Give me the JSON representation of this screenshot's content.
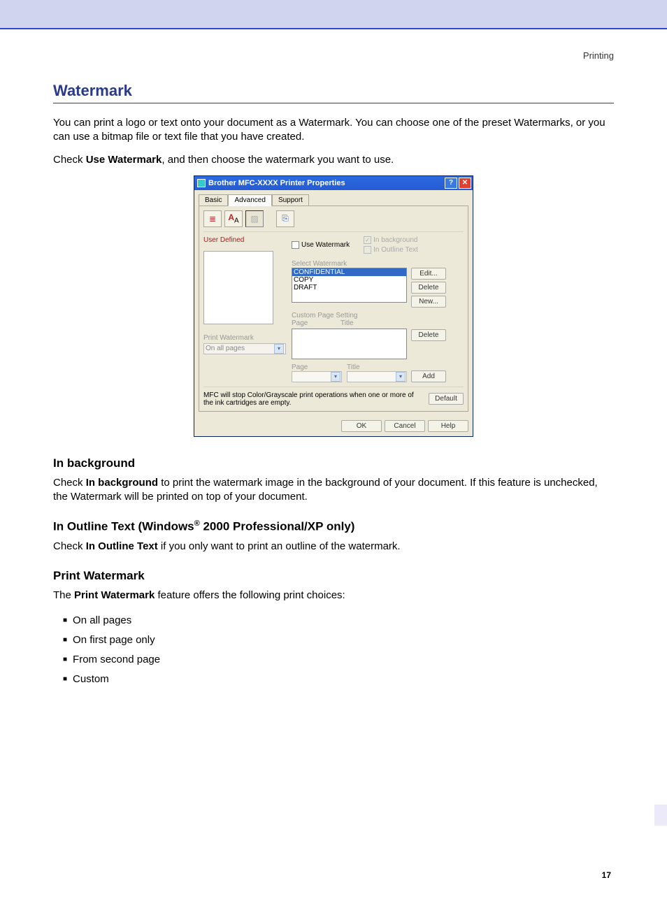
{
  "breadcrumb": "Printing",
  "title": "Watermark",
  "intro1": "You can print a logo or text onto your document as a Watermark. You can choose one of the preset Watermarks, or you can use a bitmap file or text file that you have created.",
  "intro2_pre": "Check ",
  "intro2_bold": "Use Watermark",
  "intro2_post": ", and then choose the watermark you want to use.",
  "dialog": {
    "title": "Brother MFC-XXXX Printer Properties",
    "tabs": {
      "basic": "Basic",
      "advanced": "Advanced",
      "support": "Support"
    },
    "left": {
      "user_defined": "User Defined",
      "print_watermark": "Print Watermark",
      "dd_value": "On all pages"
    },
    "checks": {
      "use_watermark": "Use Watermark",
      "in_background": "In background",
      "in_outline": "In Outline Text"
    },
    "select_label": "Select Watermark",
    "list": {
      "sel": "CONFIDENTIAL",
      "i1": "COPY",
      "i2": "DRAFT"
    },
    "btns": {
      "edit": "Edit...",
      "delete": "Delete",
      "new": "New...",
      "delete2": "Delete",
      "add": "Add",
      "default": "Default"
    },
    "custom_label": "Custom Page Setting",
    "col_page": "Page",
    "col_title": "Title",
    "note": "MFC will stop Color/Grayscale print operations when one or more of the ink cartridges are empty.",
    "footer": {
      "ok": "OK",
      "cancel": "Cancel",
      "help": "Help"
    }
  },
  "sec1": {
    "h": "In background",
    "p_pre": "Check ",
    "p_bold": "In background",
    "p_post": " to print the watermark image in the background of your document. If this feature is unchecked, the Watermark will be printed on top of your document."
  },
  "sec2": {
    "h_pre": "In Outline Text (Windows",
    "h_sup": "®",
    "h_post": " 2000 Professional/XP only)",
    "p_pre": "Check ",
    "p_bold": "In Outline Text",
    "p_post": " if you only want to print an outline of the watermark."
  },
  "sec3": {
    "h": "Print Watermark",
    "p_pre": "The ",
    "p_bold": "Print Watermark",
    "p_post": " feature offers the following print choices:",
    "items": [
      "On all pages",
      "On first page only",
      "From second page",
      "Custom"
    ]
  },
  "page_number": "17"
}
